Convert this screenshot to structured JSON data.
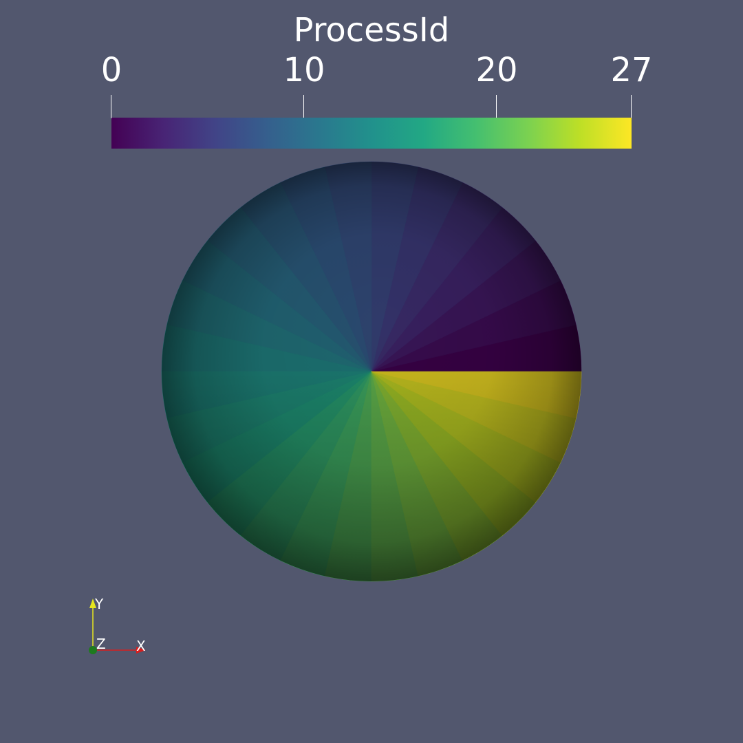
{
  "legend": {
    "title": "ProcessId",
    "range": [
      0,
      27
    ],
    "ticks": [
      {
        "value": 0,
        "label": "0"
      },
      {
        "value": 10,
        "label": "10"
      },
      {
        "value": 20,
        "label": "20"
      },
      {
        "value": 27,
        "label": "27"
      }
    ],
    "colormap": "viridis"
  },
  "sphere": {
    "partitions": 28,
    "scalar": "ProcessId"
  },
  "axes": {
    "x_label": "X",
    "y_label": "Y",
    "z_label": "Z",
    "x_color": "#d81e1e",
    "y_color": "#e6e61e",
    "z_color": "#1e7a1e"
  },
  "colors": {
    "background": "#52576e"
  }
}
